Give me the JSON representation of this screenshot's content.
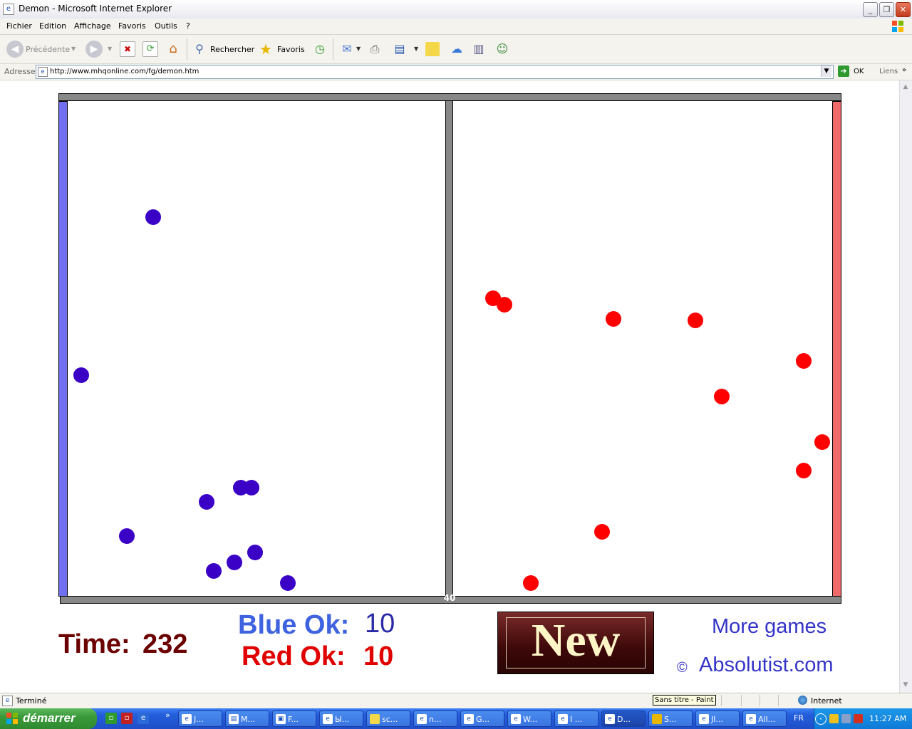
{
  "window": {
    "title": "Demon - Microsoft Internet Explorer",
    "minimize": "_",
    "maximize": "❐",
    "close": "✕"
  },
  "menu": [
    "Fichier",
    "Edition",
    "Affichage",
    "Favoris",
    "Outils",
    "?"
  ],
  "toolbar": {
    "back_label": "Précédente",
    "search_label": "Rechercher",
    "favorites_label": "Favoris"
  },
  "address": {
    "label": "Adresse",
    "url": "http://www.mhqonline.com/fg/demon.htm",
    "go_label": "OK",
    "links_label": "Liens"
  },
  "game": {
    "door_count": "40",
    "colors": {
      "blue": "#3b00c6",
      "red": "#ff0000",
      "wall_blue": "#6f6ff0",
      "wall_red": "#f06a6a"
    },
    "time_label": "Time:",
    "time_value": "232",
    "blue_label": "Blue Ok:",
    "blue_value": "10",
    "red_label": "Red Ok:",
    "red_value": "10",
    "new_button": "New",
    "more_games": "More games",
    "copyright_sign": "©",
    "site": "Absolutist.com"
  },
  "status": {
    "text": "Terminé",
    "tooltip": "Sans titre - Paint",
    "zone": "Internet"
  },
  "taskbar": {
    "start_label": "démarrer",
    "tasks": [
      "J...",
      "M...",
      "F...",
      "Ы...",
      "sc...",
      "n...",
      "G...",
      "W...",
      "I ...",
      "D...",
      "S...",
      "JI...",
      "All..."
    ],
    "language": "FR",
    "clock": "11:27 AM"
  }
}
